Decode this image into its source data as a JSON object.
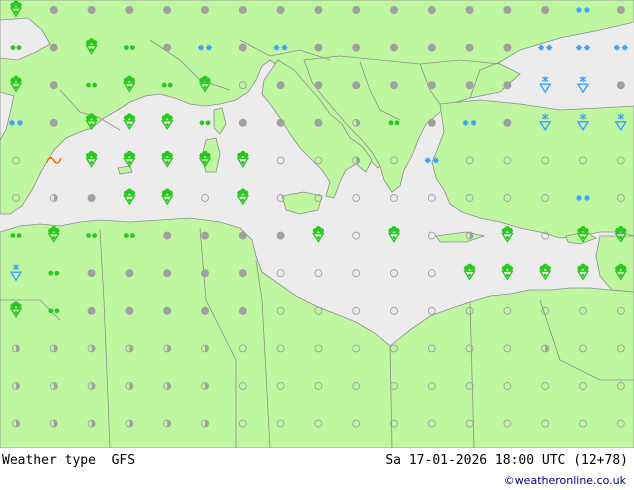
{
  "colors": {
    "land": "#bff7a0",
    "sea": "#ececec",
    "border": "#8c8c8c",
    "coast": "#8c8c8c",
    "rain": "#28c81e",
    "snow": "#3aa0ff",
    "dot": "#a0a0a0",
    "ring": "#a0a0a0",
    "fog": "#ff6a00"
  },
  "footer": {
    "title": "Weather type  GFS",
    "datetime": "Sa 17-01-2026 18:00 UTC (12+78)",
    "credit": "©weatheronline.co.uk"
  },
  "legend_symbols": {
    "dot": "overcast-dot-icon",
    "ring": "clear-ring-icon",
    "half": "partly-cloudy-icon",
    "rain": "rain-shower-icon",
    "drizzle": "drizzle-icon",
    "snow": "snow-icon",
    "snowshower": "snow-shower-icon",
    "fog": "fog-icon"
  },
  "grid": {
    "cols": 17,
    "rows": 12,
    "symbols": [
      "rain dot dot dot dot dot dot dot dot dot dot dot dot dot dot snow dot",
      "drizzle dot rain drizzle dot snow dot snow dot dot dot dot dot dot snow snow snow",
      "rain dot drizzle rain drizzle rain ring dot dot dot dot dot dot dot snowshower snowshower dot",
      "snow dot rain rain rain drizzle dot dot dot half drizzle dot snow dot snowshower snowshower snowshower",
      "ring fog rain rain rain rain rain ring ring half ring snow ring ring ring ring ring",
      "ring half dot rain rain ring rain ring ring ring ring ring ring ring ring snow ring",
      "drizzle rain drizzle drizzle dot dot dot dot rain ring rain ring half rain ring rain rain",
      "snowshower drizzle dot dot dot dot dot ring ring ring ring ring rain rain rain rain rain",
      "rain drizzle dot dot dot dot dot ring ring ring ring ring ring ring ring ring ring",
      "half half half half half half ring ring ring ring ring ring ring ring half ring ring",
      "half half half half half half ring ring ring ring ring ring ring ring ring ring ring",
      "half half half half half half ring ring ring ring ring ring ring ring ring ring ring"
    ]
  }
}
